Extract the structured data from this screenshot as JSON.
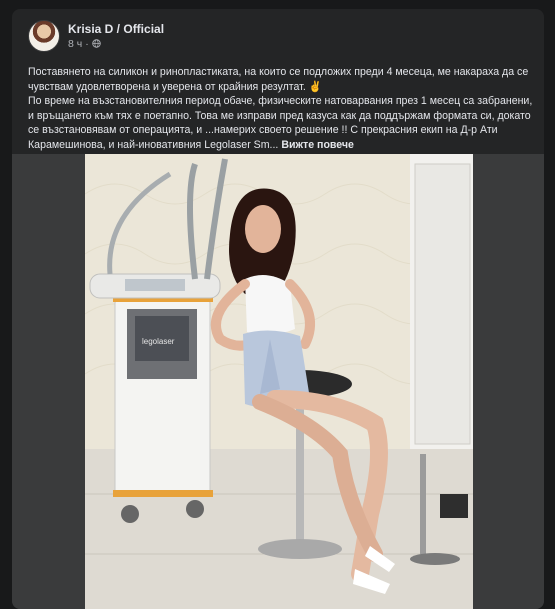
{
  "post": {
    "author": "Krisia D / Official",
    "time": "8 ч",
    "separator": "·",
    "privacy_icon": "globe-icon",
    "text_line1": "Поставянето на силикон и ринопластиката, на които се подложих преди 4 месеца, ме накараха да се чувствам удовлетворена и уверена от крайния резултат. ✌",
    "text_line2": "По време на възстановителния период обаче, физическите натоварвания през 1 месец са забранени, и връщането към тях е поетапно. Това ме изправи пред казуса как да поддържам формата си, докато се възстановявам от операцията, и ...намерих своето решение !! С прекрасния екип на Д-р Ати Карамешинова, и най-иновативния Legolaser Sm...",
    "see_more": "Вижте повече"
  },
  "photo": {
    "device_brand": "legolaser"
  },
  "colors": {
    "page_bg": "#18191a",
    "card_bg": "#242526",
    "text_primary": "#e4e6eb",
    "text_secondary": "#b0b3b8"
  }
}
